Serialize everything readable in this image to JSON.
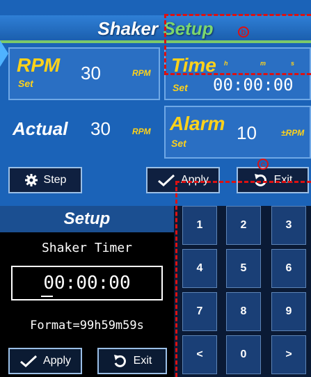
{
  "header": {
    "title_word1": "Shaker",
    "title_word2": "Setup"
  },
  "annotations": {
    "b": "b",
    "c": "c"
  },
  "rpm": {
    "label": "RPM",
    "sub": "Set",
    "value": "30",
    "unit": "RPM"
  },
  "time": {
    "label": "Time",
    "sub": "Set",
    "value": "00:00:00",
    "h": "h",
    "m": "m",
    "s": "s"
  },
  "actual": {
    "label": "Actual",
    "value": "30",
    "unit": "RPM"
  },
  "alarm": {
    "label": "Alarm",
    "sub": "Set",
    "value": "10",
    "unit": "±RPM"
  },
  "top_buttons": {
    "step": "Step",
    "apply": "Apply",
    "exit": "Exit"
  },
  "setup": {
    "title": "Setup",
    "label": "Shaker Timer",
    "value": "00:00:00",
    "format": "Format=99h59m59s",
    "apply": "Apply",
    "exit": "Exit"
  },
  "keypad": [
    [
      "1",
      "2",
      "3"
    ],
    [
      "4",
      "5",
      "6"
    ],
    [
      "7",
      "8",
      "9"
    ],
    [
      "<",
      "0",
      ">"
    ]
  ],
  "colors": {
    "panel": "#1b63b8",
    "accent_yellow": "#ffd21a",
    "accent_green": "#7cd66e",
    "annotation_red": "#dd1111"
  }
}
